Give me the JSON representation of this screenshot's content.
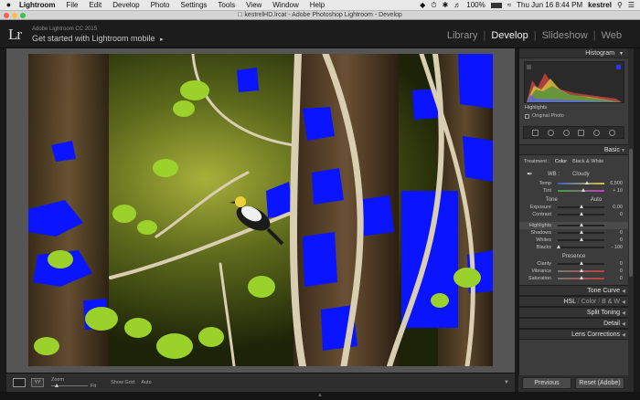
{
  "mac_menubar": {
    "app": "Lightroom",
    "items": [
      "File",
      "Edit",
      "Develop",
      "Photo",
      "Settings",
      "Tools",
      "View",
      "Window",
      "Help"
    ],
    "battery": "100%",
    "datetime": "Thu Jun 16  8:44 PM",
    "user": "kestrel"
  },
  "window": {
    "title": "kestrelHD.lrcat - Adobe Photoshop Lightroom - Develop"
  },
  "identity": {
    "logo": "Lr",
    "product": "Adobe Lightroom CC 2015",
    "mobile_prompt": "Get started with Lightroom mobile",
    "mobile_arrow": "▸"
  },
  "modules": {
    "library": "Library",
    "develop": "Develop",
    "slideshow": "Slideshow",
    "web": "Web",
    "sep": "|"
  },
  "panel": {
    "histogram_title": "Histogram",
    "highlights_label": "Highlights",
    "original_photo": "Original Photo",
    "basic_title": "Basic",
    "treatment_label": "Treatment :",
    "treatment_color": "Color",
    "treatment_bw": "Black & White",
    "wb_label": "WB :",
    "wb_value": "Cloudy",
    "tone_label": "Tone",
    "auto_label": "Auto",
    "presence_label": "Presence",
    "temp": {
      "label": "Temp",
      "value": "6,500",
      "pos": 0.62
    },
    "tint": {
      "label": "Tint",
      "value": "+ 10",
      "pos": 0.55
    },
    "exposure": {
      "label": "Exposure",
      "value": "0.00",
      "pos": 0.5
    },
    "contrast": {
      "label": "Contrast",
      "value": "0",
      "pos": 0.5
    },
    "highlights": {
      "label": "Highlights",
      "value": "",
      "pos": 0.5
    },
    "shadows": {
      "label": "Shadows",
      "value": "0",
      "pos": 0.5
    },
    "whites": {
      "label": "Whites",
      "value": "0",
      "pos": 0.5
    },
    "blacks": {
      "label": "Blacks",
      "value": "- 100",
      "pos": 0.02
    },
    "clarity": {
      "label": "Clarity",
      "value": "0",
      "pos": 0.5
    },
    "vibrance": {
      "label": "Vibrance",
      "value": "0",
      "pos": 0.5
    },
    "saturation": {
      "label": "Saturation",
      "value": "0",
      "pos": 0.5
    },
    "tone_curve": "Tone Curve",
    "hsl": "HSL",
    "color": "Color",
    "bw": "B & W",
    "slash": "/",
    "split_toning": "Split Toning",
    "detail": "Detail",
    "lens_corrections": "Lens Corrections",
    "previous": "Previous",
    "reset": "Reset (Adobe)"
  },
  "toolbar": {
    "zoom_label": "Zoom",
    "fit_label": "Fit",
    "show_grid_label": "Show Grid:",
    "show_grid_value": "Auto",
    "yy": "YY"
  },
  "colors": {
    "clipping_blue": "#0a14ff",
    "panel_bg": "#3c3c3c",
    "module_active": "#f2f2f2"
  }
}
